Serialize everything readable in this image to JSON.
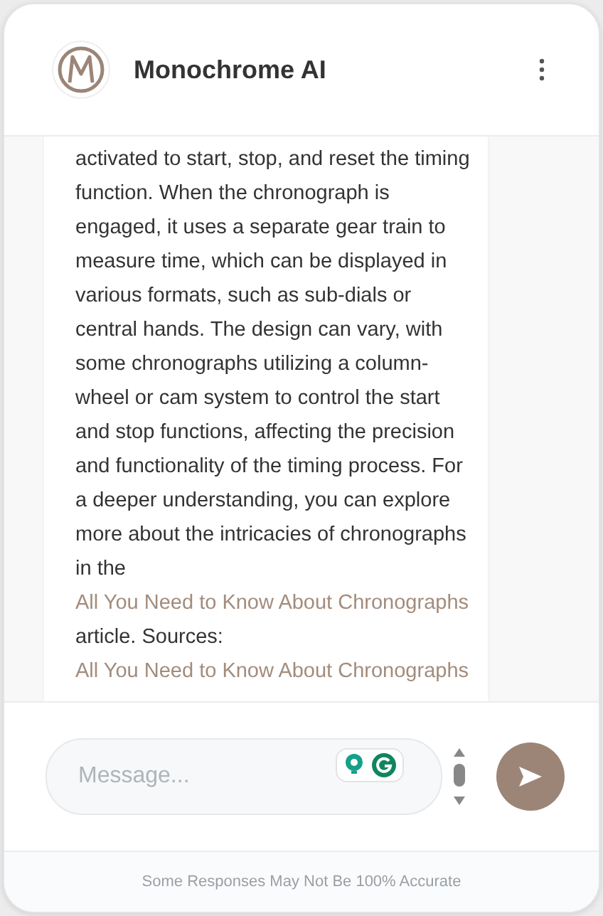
{
  "header": {
    "title": "Monochrome AI"
  },
  "message": {
    "segments": [
      {
        "kind": "text",
        "text": "activated to start, stop, and reset the timing function. When the chronograph is engaged, it uses a separate gear train to measure time, which can be displayed in various formats, such as sub-dials or central hands. The design can vary, with some chronographs utilizing a column-wheel or cam system to control the start and stop functions, affecting the precision and functionality of the timing process. For a deeper understanding, you can explore more about the intricacies of chronographs in the "
      },
      {
        "kind": "link",
        "text": "All You Need to Know About Chronographs"
      },
      {
        "kind": "text",
        "text": " article. Sources: "
      },
      {
        "kind": "link",
        "text": "All You Need to Know About Chronographs"
      }
    ]
  },
  "composer": {
    "placeholder": "Message..."
  },
  "footer": {
    "note": "Some Responses May Not Be 100% Accurate"
  }
}
